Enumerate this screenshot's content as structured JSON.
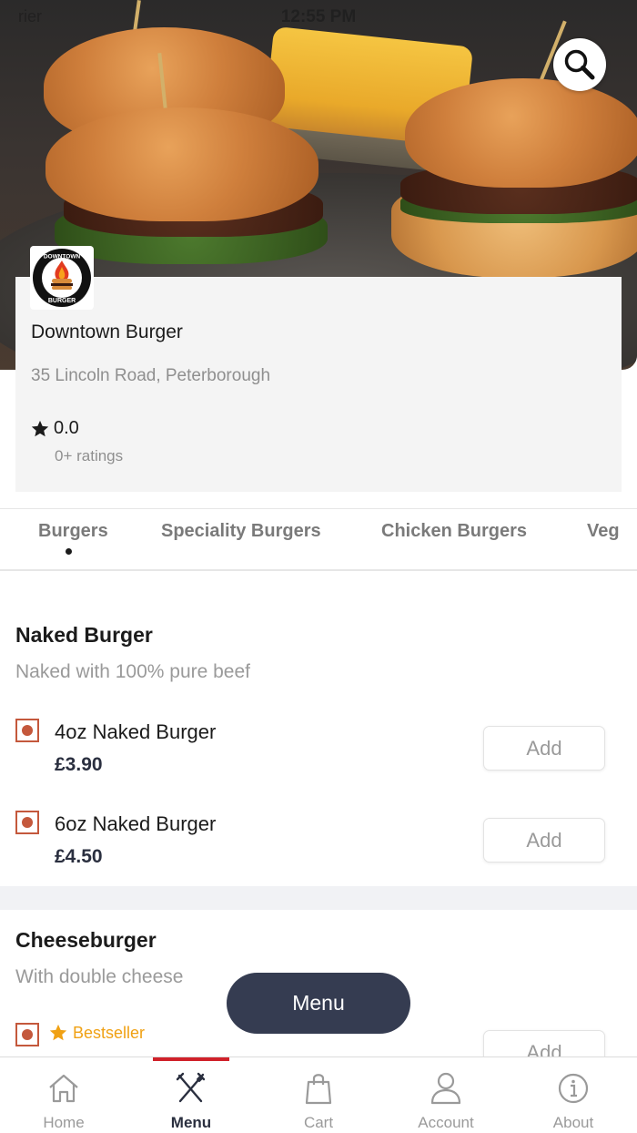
{
  "status_bar": {
    "carrier": "rier",
    "time": "12:55 PM"
  },
  "header": {
    "search_icon": "search-icon"
  },
  "restaurant": {
    "logo_text_top": "DOWNTOWN",
    "logo_text_bottom": "BURGER",
    "name": "Downtown Burger",
    "address": "35 Lincoln Road, Peterborough",
    "rating": "0.0",
    "ratings_count": "0+ ratings"
  },
  "tabs": [
    {
      "label": "Burgers",
      "active": true
    },
    {
      "label": "Speciality Burgers",
      "active": false
    },
    {
      "label": "Chicken Burgers",
      "active": false
    },
    {
      "label": "Veg",
      "active": false
    }
  ],
  "sections": [
    {
      "title": "Naked Burger",
      "description": "Naked with 100% pure beef",
      "items": [
        {
          "name": "4oz Naked Burger",
          "price": "£3.90",
          "add_label": "Add"
        },
        {
          "name": "6oz Naked Burger",
          "price": "£4.50",
          "add_label": "Add"
        }
      ]
    },
    {
      "title": "Cheeseburger",
      "description": "With double cheese",
      "items": [
        {
          "badge": "Bestseller",
          "add_label": "Add"
        }
      ]
    }
  ],
  "floating_button": {
    "label": "Menu"
  },
  "bottom_nav": [
    {
      "label": "Home",
      "icon": "home-icon",
      "active": false
    },
    {
      "label": "Menu",
      "icon": "fork-knife-icon",
      "active": true
    },
    {
      "label": "Cart",
      "icon": "bag-icon",
      "active": false
    },
    {
      "label": "Account",
      "icon": "user-icon",
      "active": false
    },
    {
      "label": "About",
      "icon": "info-icon",
      "active": false
    }
  ],
  "colors": {
    "accent_red": "#d0212a",
    "navy": "#353c51",
    "veg_mark": "#c4583c",
    "bestseller": "#f0a114"
  }
}
